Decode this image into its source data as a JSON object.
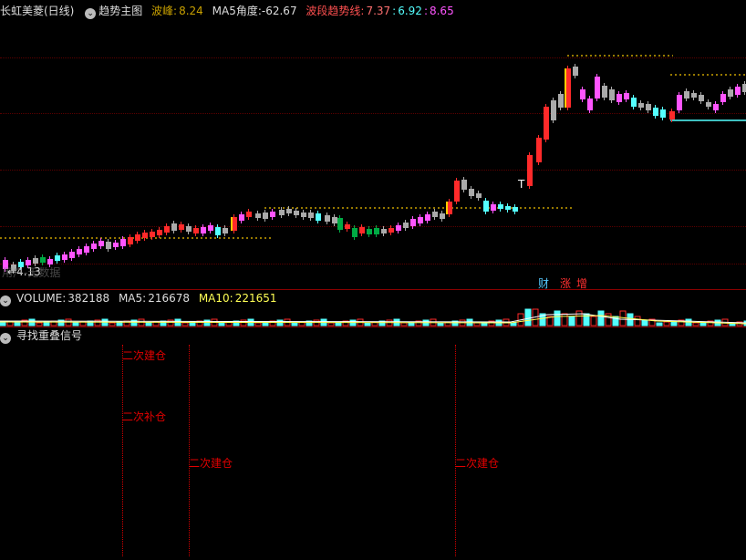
{
  "main_header": {
    "title": "长虹美菱(日线)",
    "indicator": "趋势主图",
    "peak_label": "波峰:",
    "peak_value": "8.24",
    "ma5_label": "MA5角度:",
    "ma5_value": "-62.67",
    "trend_label": "波段趋势线:",
    "trend_v1": "7.37",
    "trend_v2": "6.92",
    "trend_v3": "8.65"
  },
  "main_overlay": {
    "low_label": "4.13",
    "watermark": "用户-无数据",
    "tag_cai": "财",
    "tag_zhang": "涨",
    "tag_zeng": "增",
    "t_mark": "T"
  },
  "volume_header": {
    "label": "VOLUME:",
    "value": "382188",
    "ma5_label": "MA5:",
    "ma5_value": "216678",
    "ma10_label": "MA10:",
    "ma10_value": "221651"
  },
  "signal_header": {
    "title": "寻找重叠信号"
  },
  "signals": [
    {
      "text": "二次建仓"
    },
    {
      "text": "二次补仓"
    },
    {
      "text": "二次建仓"
    },
    {
      "text": "二次建仓"
    }
  ],
  "colors": {
    "up": "#ff2a2a",
    "down": "#54ffff",
    "magenta": "#ff55ff",
    "gray": "#aaaaaa",
    "green": "#00aa44",
    "trendline": "#c8a000"
  }
}
